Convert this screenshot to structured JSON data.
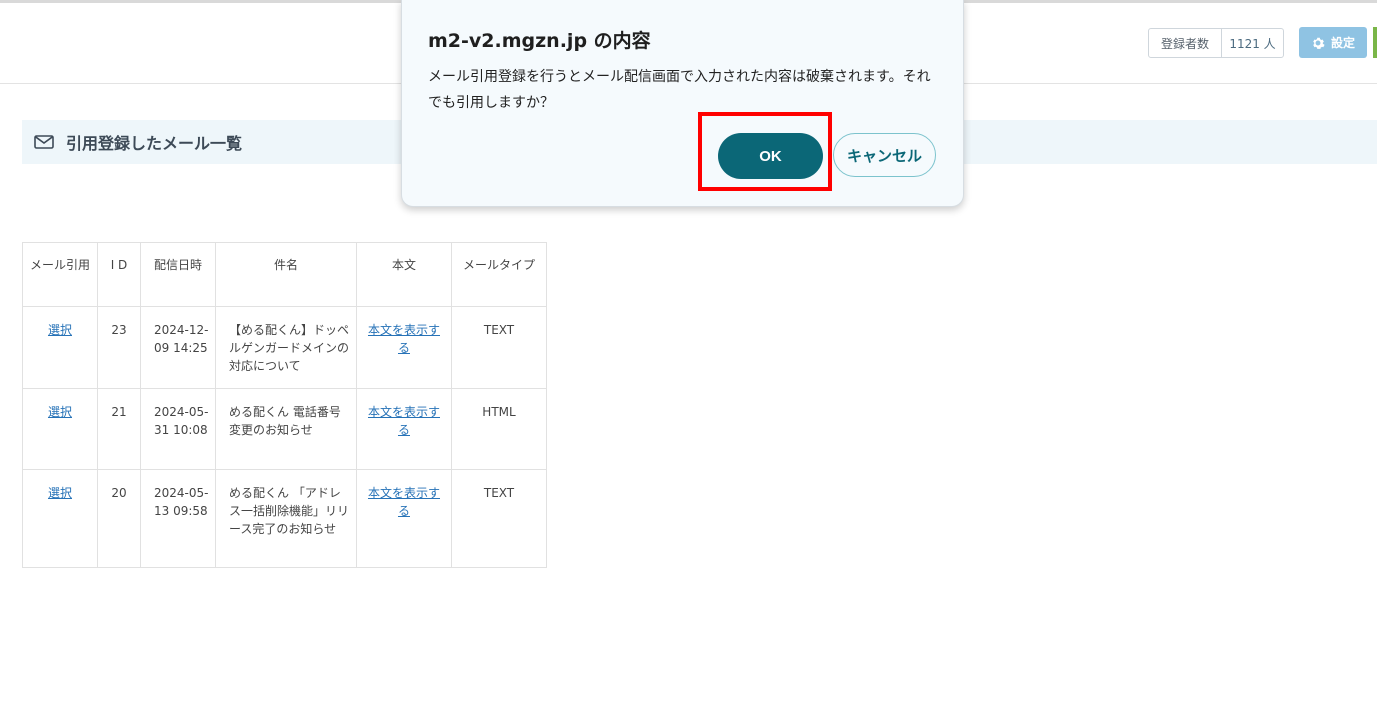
{
  "header": {
    "subscribers_label": "登録者数",
    "subscribers_count": "1121 人",
    "settings_label": "設定"
  },
  "section": {
    "title": "引用登録したメール一覧"
  },
  "table": {
    "headers": [
      "メール引用",
      "I D",
      "配信日時",
      "件名",
      "本文",
      "メールタイプ"
    ],
    "rows": [
      {
        "select": "選択",
        "id": "23",
        "date": "2024-12-09 14:25",
        "subject": "【める配くん】ドッペルゲンガードメインの対応について",
        "body_link": "本文を表示する",
        "type": "TEXT"
      },
      {
        "select": "選択",
        "id": "21",
        "date": "2024-05-31 10:08",
        "subject": "める配くん 電話番号変更のお知らせ",
        "body_link": "本文を表示する",
        "type": "HTML"
      },
      {
        "select": "選択",
        "id": "20",
        "date": "2024-05-13 09:58",
        "subject": "める配くん 「アドレス一括削除機能」リリース完了のお知らせ",
        "body_link": "本文を表示する",
        "type": "TEXT"
      }
    ]
  },
  "dialog": {
    "title": "m2-v2.mgzn.jp の内容",
    "message": "メール引用登録を行うとメール配信画面で入力された内容は破棄されます。それでも引用しますか？",
    "ok_label": "OK",
    "cancel_label": "キャンセル"
  },
  "colors": {
    "primary": "#0b6777",
    "settings": "#8fc3e3",
    "highlight": "#ff0000",
    "link": "#2672b7"
  }
}
